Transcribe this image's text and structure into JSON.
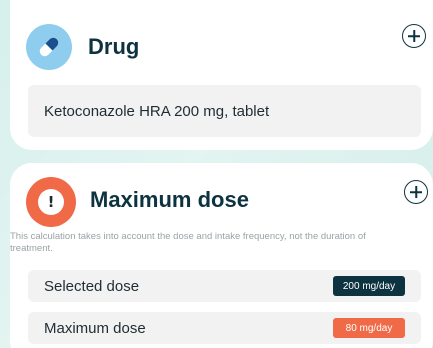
{
  "drug_card": {
    "title": "Drug",
    "value": "Ketoconazole HRA 200 mg, tablet",
    "icon": "pill-icon",
    "add_icon": "plus-circle-icon"
  },
  "dose_card": {
    "title": "Maximum dose",
    "icon": "exclamation-icon",
    "icon_glyph": "!",
    "add_icon": "plus-circle-icon",
    "note": "This calculation takes into account the dose and intake frequency, not the duration of treatment.",
    "rows": [
      {
        "label": "Selected dose",
        "value": "200 mg/day",
        "color": "#0e3340"
      },
      {
        "label": "Maximum dose",
        "value": "80 mg/day",
        "color": "#f06a48"
      }
    ]
  },
  "colors": {
    "drug_icon_bg": "#8fcdee",
    "alert_icon_bg": "#f06a48",
    "title_text": "#0e3340",
    "background": "#dcf1ed"
  }
}
